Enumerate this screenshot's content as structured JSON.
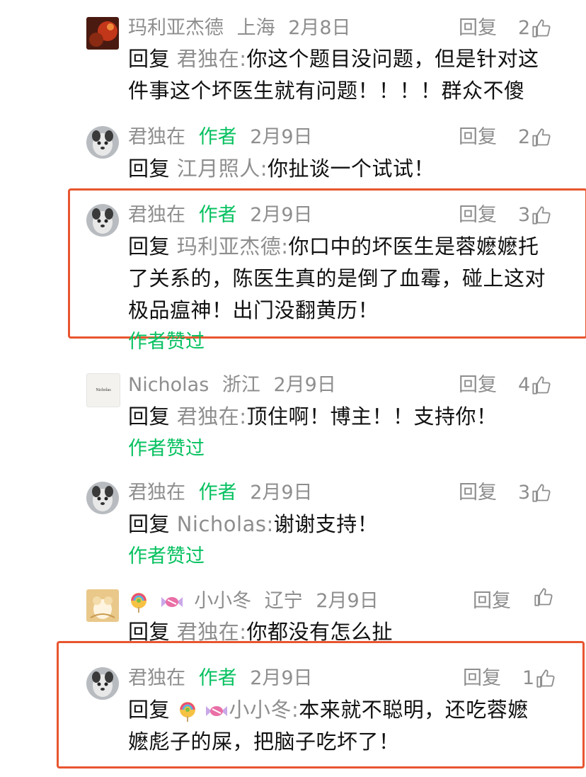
{
  "comments": [
    {
      "name": "玛利亚杰德",
      "author_tag": "",
      "location": "上海",
      "date": "2月8日",
      "reply_label": "回复",
      "likes": "2",
      "reply_prefix": "回复",
      "reply_target": "玛利亚杰德",
      "target": "君独在:",
      "text_line1": "你这个题目没问题，但是针对这",
      "text_line2": "件事这个坏医生就有问题！！！！群众不傻",
      "author_liked": ""
    },
    {
      "name": "君独在",
      "author_tag": "作者",
      "location": "",
      "date": "2月9日",
      "reply_label": "回复",
      "likes": "2",
      "reply_prefix": "回复",
      "target": "江月照人:",
      "text_line1": "你扯谈一个试试！",
      "author_liked": ""
    },
    {
      "name": "君独在",
      "author_tag": "作者",
      "date": "2月9日",
      "reply_label": "回复",
      "likes": "3",
      "reply_prefix": "回复",
      "target": "玛利亚杰德:",
      "text_line1": "你口中的坏医生是蓉嬷嬷托",
      "text_line2": "了关系的，陈医生真的是倒了血霉，碰上这对",
      "text_line3": "极品瘟神！出门没翻黄历！",
      "author_liked": "作者赞过"
    },
    {
      "name": "Nicholas",
      "location": "浙江",
      "date": "2月9日",
      "reply_label": "回复",
      "likes": "4",
      "reply_prefix": "回复",
      "target": "君独在:",
      "text_line1": "顶住啊！博主！！支持你！",
      "author_liked": "作者赞过",
      "avatar_text": "Nicholas"
    },
    {
      "name": "君独在",
      "author_tag": "作者",
      "date": "2月9日",
      "reply_label": "回复",
      "likes": "3",
      "reply_prefix": "回复",
      "target": "Nicholas:",
      "text_line1": "谢谢支持！",
      "author_liked": "作者赞过"
    },
    {
      "name": "小小冬",
      "location": "辽宁",
      "date": "2月9日",
      "reply_label": "回复",
      "likes": "",
      "reply_prefix": "回复",
      "target": "君独在:",
      "text_line1": "你都没有怎么扯"
    },
    {
      "name": "君独在",
      "author_tag": "作者",
      "date": "2月9日",
      "reply_label": "回复",
      "likes": "1",
      "reply_prefix": "回复",
      "target": "小小冬:",
      "text_line1": "本来就不聪明，还吃蓉嬷",
      "text_line2": "嬷彪子的屎，把脑子吃坏了！"
    }
  ],
  "colors": {
    "author_green": "#07c160",
    "highlight_red": "#e8552f",
    "meta_gray": "#8e8e8e"
  },
  "icons": {
    "like": "thumbs-up-icon",
    "lollipop": "lollipop-icon",
    "candy": "candy-icon"
  }
}
